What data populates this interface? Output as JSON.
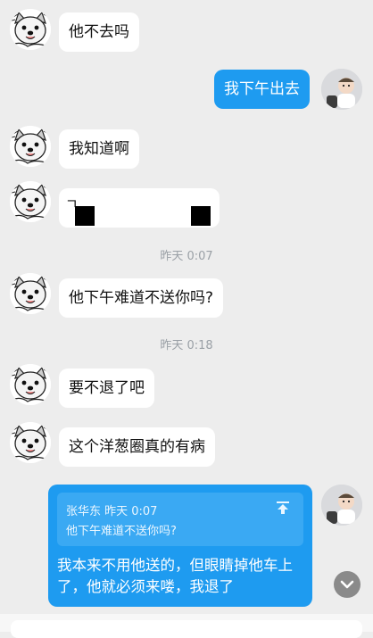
{
  "messages": [
    {
      "text": "他不去吗"
    },
    {
      "text": "我下午出去"
    },
    {
      "text": "我知道啊"
    },
    {
      "text": "ㄱ"
    },
    {
      "text": "他下午难道不送你吗?"
    },
    {
      "text": "要不退了吧"
    },
    {
      "text": "这个洋葱圈真的有病"
    }
  ],
  "timestamps": [
    "昨天 0:07",
    "昨天 0:18"
  ],
  "reply": {
    "quote_meta": "张华东  昨天 0:07",
    "quote_text": "他下午难道不送你吗?",
    "text": "我本来不用他送的，但眼睛掉他车上了，他就必须来喽，我退了"
  },
  "colors": {
    "background": "#ededed",
    "my_bubble": "#1e9bf0",
    "their_bubble": "#ffffff"
  },
  "icons": {
    "contact_avatar": "dog-avatar-icon",
    "my_avatar": "baby-avatar-icon",
    "quote_jump": "arrow-up-icon",
    "scroll_down": "chevron-down-icon"
  }
}
